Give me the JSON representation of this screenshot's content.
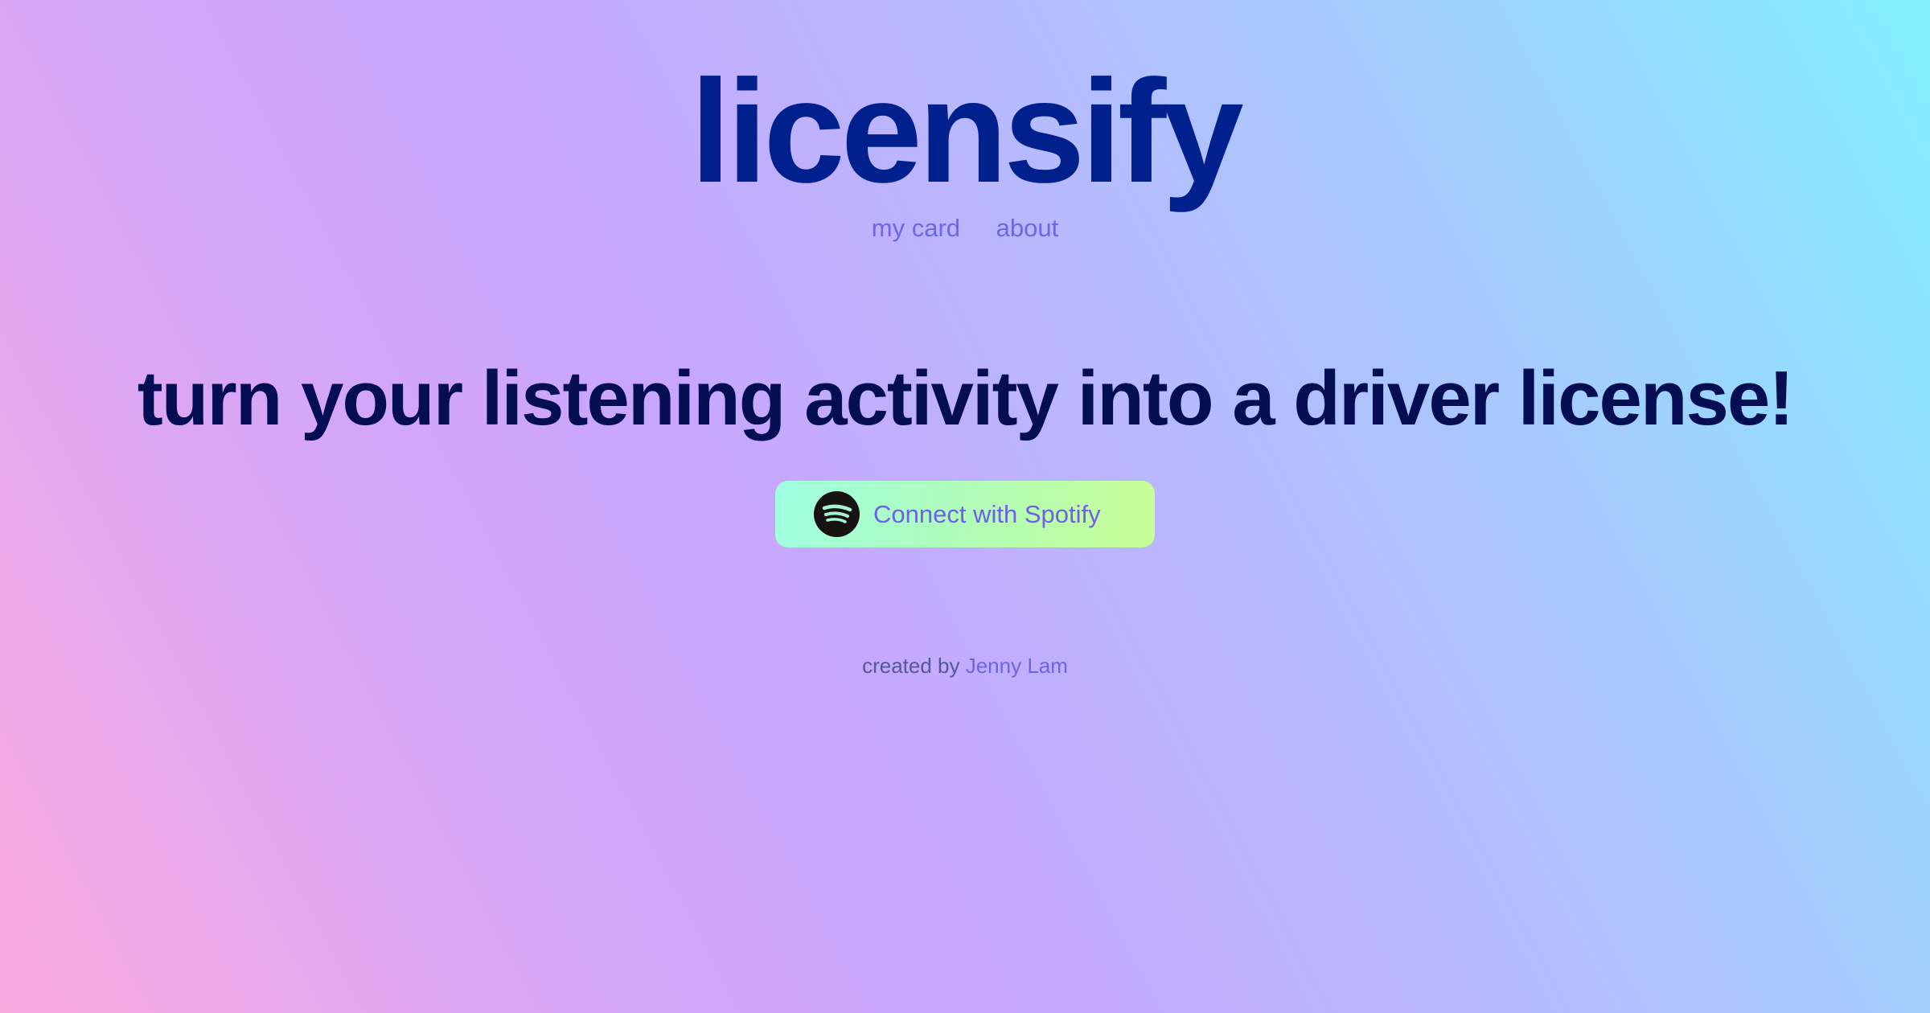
{
  "header": {
    "logo": "licensify",
    "nav": [
      {
        "label": "my card"
      },
      {
        "label": "about"
      }
    ]
  },
  "main": {
    "headline": "turn your listening activity into a driver license!",
    "connect_button": {
      "label": "Connect with Spotify",
      "icon": "spotify-icon"
    }
  },
  "footer": {
    "prefix": "created by",
    "author": "Jenny Lam"
  },
  "colors": {
    "logo": "#00208e",
    "headline": "#050e52",
    "accent": "#6e66e8"
  }
}
